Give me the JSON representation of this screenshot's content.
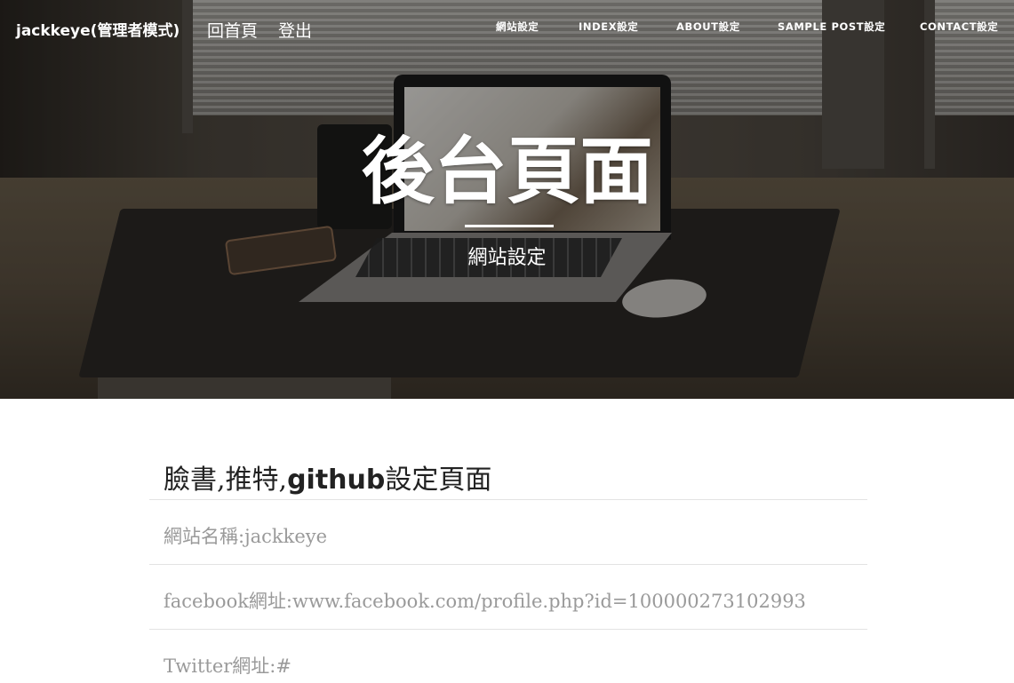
{
  "nav": {
    "brand": "jackkeye(管理者模式)",
    "left_links": [
      "回首頁",
      "登出"
    ],
    "right_links": [
      "網站設定",
      "INDEX設定",
      "ABOUT設定",
      "SAMPLE POST設定",
      "CONTACT設定"
    ]
  },
  "hero": {
    "title": "後台頁面",
    "subtitle": "網站設定"
  },
  "section": {
    "title_part1": "臉書,推特,",
    "title_part2": "github",
    "title_part3": "設定頁面",
    "rows": [
      "網站名稱:jackkeye",
      "facebook網址:www.facebook.com/profile.php?id=100000273102993",
      "Twitter網址:#"
    ]
  }
}
